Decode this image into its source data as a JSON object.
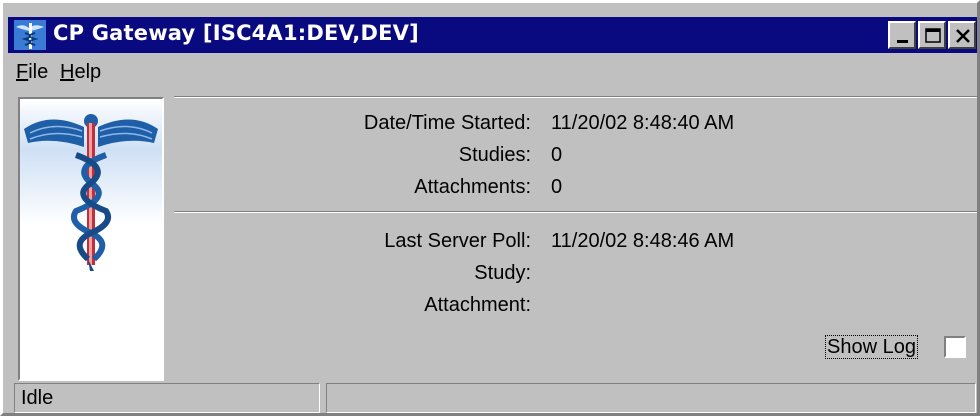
{
  "window": {
    "title": "CP Gateway [ISC4A1:DEV,DEV]",
    "icon": "caduceus-icon",
    "controls": [
      "minimize-icon",
      "maximize-icon",
      "close-icon"
    ]
  },
  "menu": {
    "items": [
      {
        "label": "File",
        "mnemonic": "F"
      },
      {
        "label": "Help",
        "mnemonic": "H"
      }
    ]
  },
  "logo": {
    "icon": "caduceus-icon"
  },
  "session": {
    "started_label": "Date/Time Started:",
    "started_value": "11/20/02 8:48:40 AM",
    "studies_label": "Studies:",
    "studies_value": "0",
    "attachments_label": "Attachments:",
    "attachments_value": "0"
  },
  "server": {
    "poll_label": "Last Server Poll:",
    "poll_value": "11/20/02 8:48:46 AM",
    "study_label": "Study:",
    "study_value": "",
    "attachment_label": "Attachment:",
    "attachment_value": ""
  },
  "show_log": {
    "label": "Show Log",
    "checked": false
  },
  "status": {
    "text": "Idle",
    "secondary": ""
  },
  "colors": {
    "titlebar": "#0a0a80",
    "face": "#c0c0c0",
    "logo_blue": "#1f5fa8",
    "logo_red": "#c0303a"
  }
}
